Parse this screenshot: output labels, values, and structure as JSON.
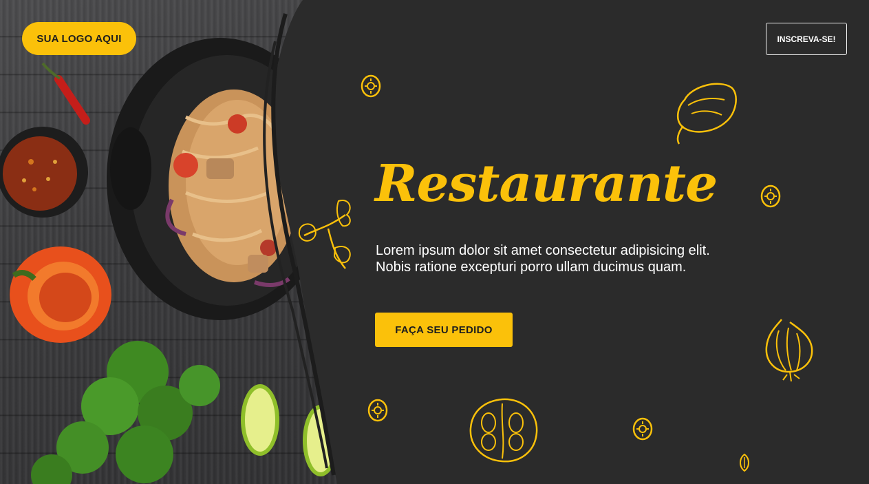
{
  "header": {
    "logo_label": "SUA LOGO AQUI",
    "signup_label": "INSCREVA-SE!"
  },
  "hero": {
    "title": "Restaurante",
    "description": "Lorem ipsum dolor sit amet consectetur adipisicing elit. Nobis ratione excepturi porro ullam ducimus quam.",
    "cta_label": "FAÇA SEU PEDIDO"
  },
  "colors": {
    "accent": "#fbc10a",
    "panel": "#2b2b2b",
    "text": "#ffffff"
  },
  "icons": [
    "pepper-icon",
    "parsley-icon",
    "garlic-icon",
    "tomato-icon",
    "lemon-slice-icon",
    "seed-icon"
  ]
}
